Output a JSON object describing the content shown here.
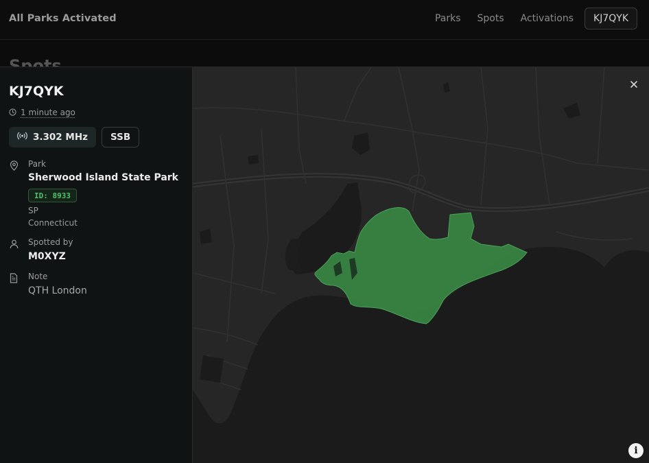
{
  "header": {
    "brand": "All Parks Activated",
    "nav": [
      "Parks",
      "Spots",
      "Activations"
    ],
    "user": "KJ7QYK"
  },
  "page": {
    "title": "Spots"
  },
  "spot": {
    "callsign": "KJ7QYK",
    "time_ago": "1 minute ago",
    "frequency": "3.302 MHz",
    "mode": "SSB",
    "park_label": "Park",
    "park_name": "Sherwood Island State Park",
    "park_id": "ID: 8933",
    "park_type": "SP",
    "park_state": "Connecticut",
    "spotted_by_label": "Spotted by",
    "spotted_by": "M0XYZ",
    "note_label": "Note",
    "note": "QTH London"
  },
  "map": {
    "park_fill_color": "#3a8f46",
    "water_color": "#1b1b1b",
    "land_color": "#262626"
  },
  "icons": {
    "close": "close-icon",
    "info": "info-icon",
    "clock": "clock-icon",
    "radio": "radio-waves-icon",
    "pin": "map-pin-icon",
    "user": "user-icon",
    "note": "note-icon"
  }
}
